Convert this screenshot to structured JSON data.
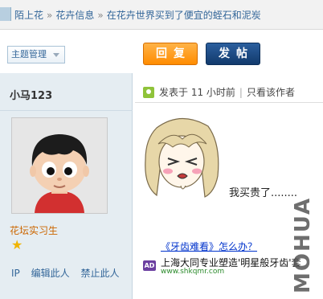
{
  "breadcrumb": {
    "items": [
      "陌上花",
      "花卉信息",
      "在花卉世界买到了便宜的蛭石和泥炭"
    ],
    "separator": "»"
  },
  "toolbar": {
    "topic_manage_label": "主题管理",
    "reply_label": "回复",
    "post_label": "发帖"
  },
  "author": {
    "name": "小马123",
    "rank": "花坛实习生",
    "star_icon": "star-icon",
    "actions": [
      "IP",
      "编辑此人",
      "禁止此人"
    ]
  },
  "post": {
    "meta_posted": "发表于 11 小时前",
    "meta_author_only": "只看该作者",
    "body": "我买贵了........",
    "sticker_icon": "crying-anime-girl-sticker"
  },
  "ad": {
    "title": "《牙齿难看》怎么办？",
    "badge": "AD",
    "body": "上海大同专业塑造'明星般牙齿'套",
    "url": "www.shkqmr.com"
  },
  "watermark": "MOHUA",
  "colors": {
    "reply_button": "#ff8c00",
    "post_button": "#123a6c",
    "sidebar_bg": "#e5edf2",
    "link": "#336699",
    "rank": "#cc6600"
  }
}
